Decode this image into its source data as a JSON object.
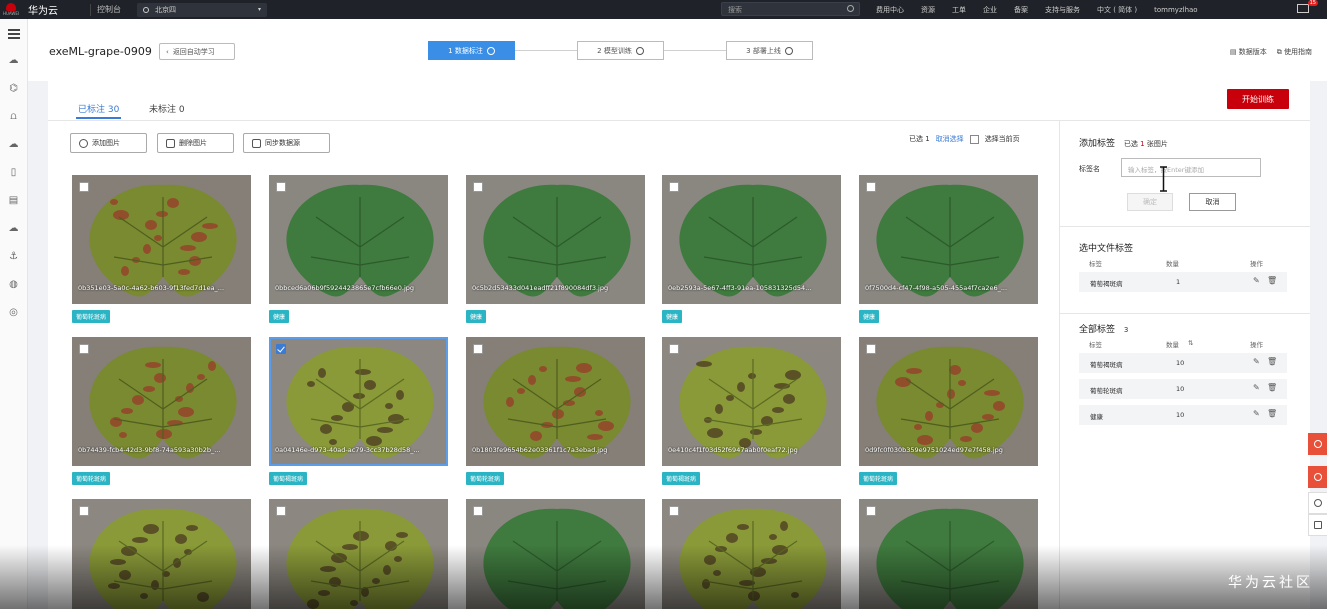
{
  "topbar": {
    "logo_caption": "HUAWEI",
    "brand": "华为云",
    "console": "控制台",
    "region": "北京四",
    "search_placeholder": "搜索",
    "nav": [
      "费用中心",
      "资源",
      "工单",
      "企业",
      "备案",
      "支持与服务",
      "中文 ( 简体 )",
      "tommyzlhao"
    ],
    "mail_badge": "15"
  },
  "header": {
    "project_name": "exeML-grape-0909",
    "back_label": "返回自动学习",
    "steps": [
      "1 数据标注",
      "2 模型训练",
      "3 部署上线"
    ],
    "links": [
      "数据版本",
      "使用指南"
    ]
  },
  "tabs": {
    "labeled": "已标注 30",
    "unlabeled": "未标注 0"
  },
  "start_train": "开始训练",
  "toolbar": {
    "add": "添加图片",
    "delete": "删除图片",
    "sync": "同步数据源"
  },
  "selection": {
    "selected": "已选 1",
    "cancel": "取消选择",
    "select_page": "选择当前页"
  },
  "images": [
    {
      "file": "0b351e03-5a0c-4a62-b603-9f13fed7d1ea_...",
      "tag": "葡萄轮斑病",
      "kind": "sick",
      "selected": false
    },
    {
      "file": "0bbced6a06b9f5924423865e7cfb66e0.jpg",
      "tag": "健康",
      "kind": "healthy",
      "selected": false
    },
    {
      "file": "0c5b2d53433d041eadff21f890084df3.jpg",
      "tag": "健康",
      "kind": "healthy",
      "selected": false
    },
    {
      "file": "0eb2593a-5e67-4ff3-91ea-105831325d54...",
      "tag": "健康",
      "kind": "healthy",
      "selected": false
    },
    {
      "file": "0f7500d4-cf47-4f98-a505-455a4f7ca2e6_...",
      "tag": "健康",
      "kind": "healthy",
      "selected": false
    },
    {
      "file": "0b74439-fcb4-42d3-9bf8-74a593a30b2b_...",
      "tag": "葡萄轮斑病",
      "kind": "sick",
      "selected": false
    },
    {
      "file": "0a04146e-d973-40ad-ac79-3cc37b28d58_...",
      "tag": "葡萄褐斑病",
      "kind": "spot",
      "selected": true
    },
    {
      "file": "0b1803fe9654b62e03361f1c7a3ebad.jpg",
      "tag": "葡萄轮斑病",
      "kind": "sick",
      "selected": false
    },
    {
      "file": "0e410c4f1f03d52f6947aab0f0eaf72.jpg",
      "tag": "葡萄褐斑病",
      "kind": "spot",
      "selected": false
    },
    {
      "file": "0d9fc0f030b359e9751024ed97e7f458.jpg",
      "tag": "葡萄轮斑病",
      "kind": "sick",
      "selected": false
    },
    {
      "file": "",
      "tag": "",
      "kind": "spot",
      "selected": false
    },
    {
      "file": "",
      "tag": "",
      "kind": "spot",
      "selected": false
    },
    {
      "file": "",
      "tag": "",
      "kind": "healthy",
      "selected": false
    },
    {
      "file": "",
      "tag": "",
      "kind": "spot",
      "selected": false
    },
    {
      "file": "",
      "tag": "",
      "kind": "healthy",
      "selected": false
    }
  ],
  "side": {
    "add_title": "添加标签",
    "add_sub_pre": "已选",
    "add_sub_num": "1",
    "add_sub_post": "张图片",
    "label_name": "标签名",
    "input_placeholder": "输入标签，按Enter键添加",
    "ok": "确定",
    "cancel": "取消",
    "file_tags_title": "选中文件标签",
    "col_tag": "标签",
    "col_count": "数量",
    "col_op": "操作",
    "file_tags": [
      {
        "name": "葡萄褐斑病",
        "count": "1"
      }
    ],
    "all_tags_title": "全部标签",
    "all_tags_count": "3",
    "all_tags": [
      {
        "name": "葡萄褐斑病",
        "count": "10"
      },
      {
        "name": "葡萄轮斑病",
        "count": "10"
      },
      {
        "name": "健康",
        "count": "10"
      }
    ]
  },
  "watermark": "华为云社区"
}
